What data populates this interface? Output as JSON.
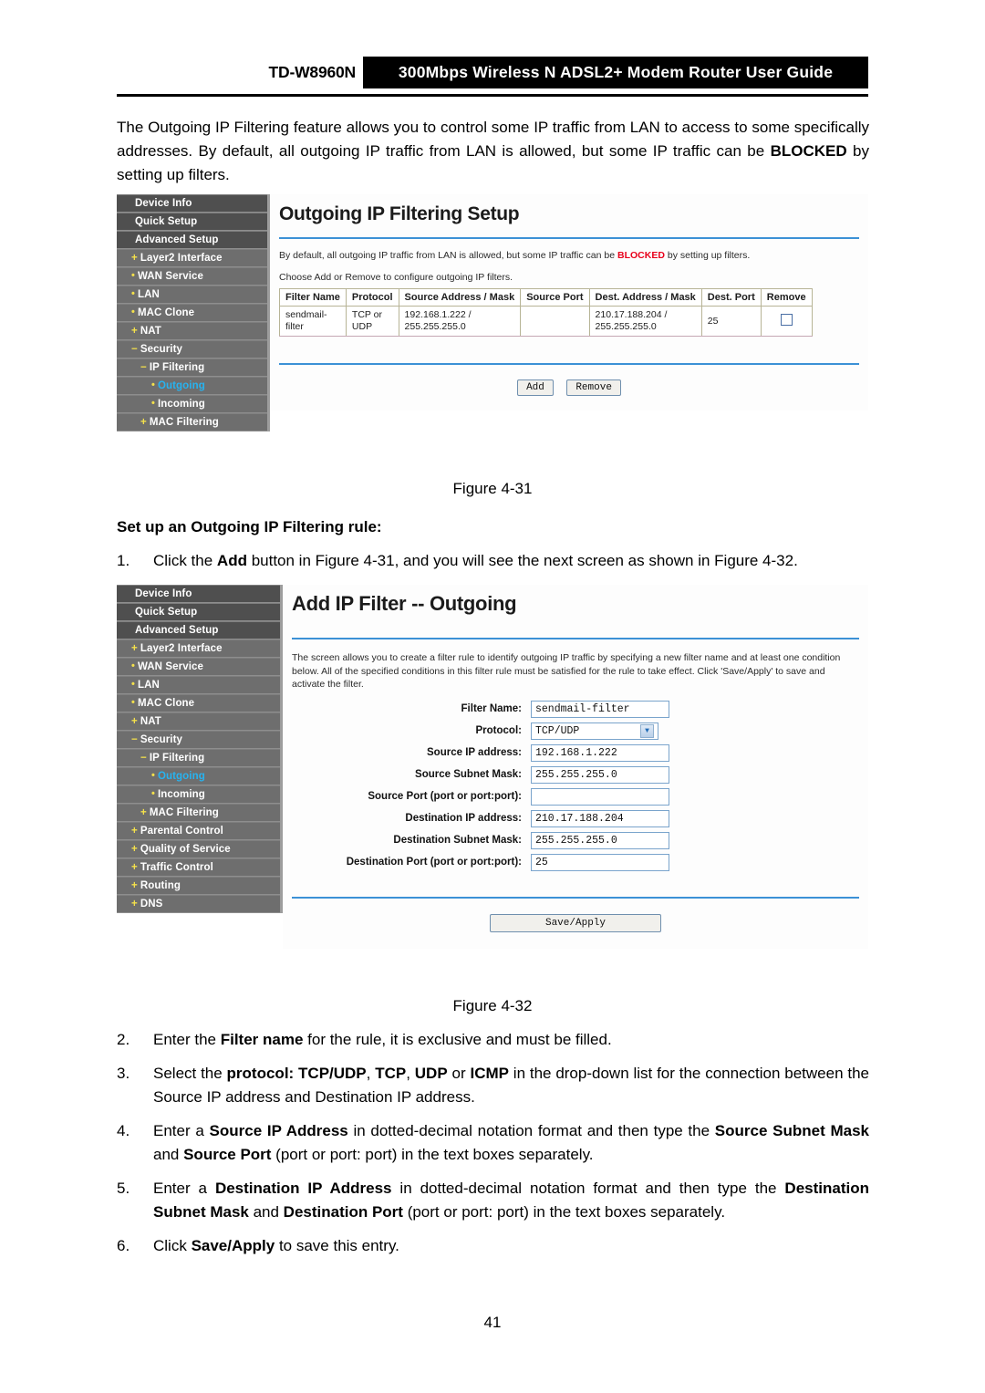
{
  "header": {
    "model": "TD-W8960N",
    "title": "300Mbps Wireless N ADSL2+ Modem Router User Guide"
  },
  "intro": {
    "part1": "The Outgoing IP Filtering feature allows you to control some IP traffic from LAN to access to some specifically addresses. By default, all outgoing IP traffic from LAN is allowed, but some IP traffic can be ",
    "blocked": "BLOCKED",
    "part2": " by setting up filters."
  },
  "figure1": {
    "caption": "Figure 4-31",
    "panel_title": "Outgoing IP Filtering Setup",
    "note_before": "By default, all outgoing IP traffic from LAN is allowed, but some IP traffic can be ",
    "note_blocked": "BLOCKED",
    "note_after": " by setting up filters.",
    "note2": "Choose Add or Remove to configure outgoing IP filters.",
    "table": {
      "headers": [
        "Filter Name",
        "Protocol",
        "Source Address / Mask",
        "Source Port",
        "Dest. Address / Mask",
        "Dest. Port",
        "Remove"
      ],
      "rows": [
        {
          "filter_name": "sendmail-filter",
          "protocol": "TCP or UDP",
          "source_address_mask": "192.168.1.222 / 255.255.255.0",
          "source_port": "",
          "dest_address_mask": "210.17.188.204 / 255.255.255.0",
          "dest_port": "25",
          "remove": false
        }
      ]
    },
    "buttons": {
      "add": "Add",
      "remove": "Remove"
    },
    "sidebar": [
      {
        "label": "Device Info",
        "level": "top",
        "marker": "",
        "selected": false
      },
      {
        "label": "Quick Setup",
        "level": "top",
        "marker": "",
        "selected": false
      },
      {
        "label": "Advanced Setup",
        "level": "top",
        "marker": "",
        "selected": false
      },
      {
        "label": "Layer2 Interface",
        "level": "lvl1",
        "marker": "+",
        "selected": false
      },
      {
        "label": "WAN Service",
        "level": "lvl1",
        "marker": "•",
        "selected": false
      },
      {
        "label": "LAN",
        "level": "lvl1",
        "marker": "•",
        "selected": false
      },
      {
        "label": "MAC Clone",
        "level": "lvl1",
        "marker": "•",
        "selected": false
      },
      {
        "label": "NAT",
        "level": "lvl1",
        "marker": "+",
        "selected": false
      },
      {
        "label": "Security",
        "level": "lvl1",
        "marker": "−",
        "selected": false
      },
      {
        "label": "IP Filtering",
        "level": "lvl2",
        "marker": "−",
        "selected": false
      },
      {
        "label": "Outgoing",
        "level": "lvl3",
        "marker": "•",
        "selected": true
      },
      {
        "label": "Incoming",
        "level": "lvl3",
        "marker": "•",
        "selected": false
      },
      {
        "label": "MAC Filtering",
        "level": "lvl2",
        "marker": "+",
        "selected": false
      }
    ]
  },
  "section_title": "Set up an Outgoing IP Filtering rule:",
  "figure2": {
    "caption": "Figure 4-32",
    "panel_title": "Add IP Filter -- Outgoing",
    "description": "The screen allows you to create a filter rule to identify outgoing IP traffic by specifying a new filter name and at least one condition below. All of the specified conditions in this filter rule must be satisfied for the rule to take effect. Click 'Save/Apply' to save and activate the filter.",
    "fields": [
      {
        "label": "Filter Name:",
        "type": "text",
        "value": "sendmail-filter"
      },
      {
        "label": "Protocol:",
        "type": "select",
        "value": "TCP/UDP",
        "options": [
          "TCP/UDP",
          "TCP",
          "UDP",
          "ICMP"
        ]
      },
      {
        "label": "Source IP address:",
        "type": "text",
        "value": "192.168.1.222"
      },
      {
        "label": "Source Subnet Mask:",
        "type": "text",
        "value": "255.255.255.0"
      },
      {
        "label": "Source Port (port or port:port):",
        "type": "text",
        "value": ""
      },
      {
        "label": "Destination IP address:",
        "type": "text",
        "value": "210.17.188.204"
      },
      {
        "label": "Destination Subnet Mask:",
        "type": "text",
        "value": "255.255.255.0"
      },
      {
        "label": "Destination Port (port or port:port):",
        "type": "text",
        "value": "25"
      }
    ],
    "save_button": "Save/Apply",
    "sidebar": [
      {
        "label": "Device Info",
        "level": "top",
        "marker": "",
        "selected": false
      },
      {
        "label": "Quick Setup",
        "level": "top",
        "marker": "",
        "selected": false
      },
      {
        "label": "Advanced Setup",
        "level": "top",
        "marker": "",
        "selected": false
      },
      {
        "label": "Layer2 Interface",
        "level": "lvl1",
        "marker": "+",
        "selected": false
      },
      {
        "label": "WAN Service",
        "level": "lvl1",
        "marker": "•",
        "selected": false
      },
      {
        "label": "LAN",
        "level": "lvl1",
        "marker": "•",
        "selected": false
      },
      {
        "label": "MAC Clone",
        "level": "lvl1",
        "marker": "•",
        "selected": false
      },
      {
        "label": "NAT",
        "level": "lvl1",
        "marker": "+",
        "selected": false
      },
      {
        "label": "Security",
        "level": "lvl1",
        "marker": "−",
        "selected": false
      },
      {
        "label": "IP Filtering",
        "level": "lvl2",
        "marker": "−",
        "selected": false
      },
      {
        "label": "Outgoing",
        "level": "lvl3",
        "marker": "•",
        "selected": true
      },
      {
        "label": "Incoming",
        "level": "lvl3",
        "marker": "•",
        "selected": false
      },
      {
        "label": "MAC Filtering",
        "level": "lvl2",
        "marker": "+",
        "selected": false
      },
      {
        "label": "Parental Control",
        "level": "lvl1",
        "marker": "+",
        "selected": false
      },
      {
        "label": "Quality of Service",
        "level": "lvl1",
        "marker": "+",
        "selected": false
      },
      {
        "label": "Traffic Control",
        "level": "lvl1",
        "marker": "+",
        "selected": false
      },
      {
        "label": "Routing",
        "level": "lvl1",
        "marker": "+",
        "selected": false
      },
      {
        "label": "DNS",
        "level": "lvl1",
        "marker": "+",
        "selected": false
      }
    ]
  },
  "steps": [
    {
      "num": "1.",
      "html": "Click the <b>Add</b> button in Figure 4-31, and you will see the next screen as shown in Figure 4-32."
    },
    {
      "num": "2.",
      "html": "Enter the <b>Filter name</b> for the rule, it is exclusive and must be filled."
    },
    {
      "num": "3.",
      "html": "Select the <b>protocol: TCP/UDP</b>, <b>TCP</b>, <b>UDP</b> or <b>ICMP</b> in the drop-down list for the connection between the Source IP address and Destination IP address."
    },
    {
      "num": "4.",
      "html": "Enter a <b>Source IP Address</b> in dotted-decimal notation format and then type the <b>Source Subnet Mask</b> and <b>Source Port</b> (port or port: port) in the text boxes separately."
    },
    {
      "num": "5.",
      "html": "Enter a <b>Destination IP Address</b> in dotted-decimal notation format and then type the <b>Destination Subnet Mask</b> and <b>Destination Port</b> (port or port: port) in the text boxes separately."
    },
    {
      "num": "6.",
      "html": "Click <b>Save/Apply</b> to save this entry."
    }
  ],
  "page_number": "41",
  "colors": {
    "sidebar_bg": "#6e6e6e",
    "sidebar_top_bg": "#4f6e6e",
    "accent_blue": "#3c91d6",
    "selected_link": "#27b3f0",
    "marker_yellow": "#f4e14b",
    "blocked_red": "#e8001b"
  }
}
